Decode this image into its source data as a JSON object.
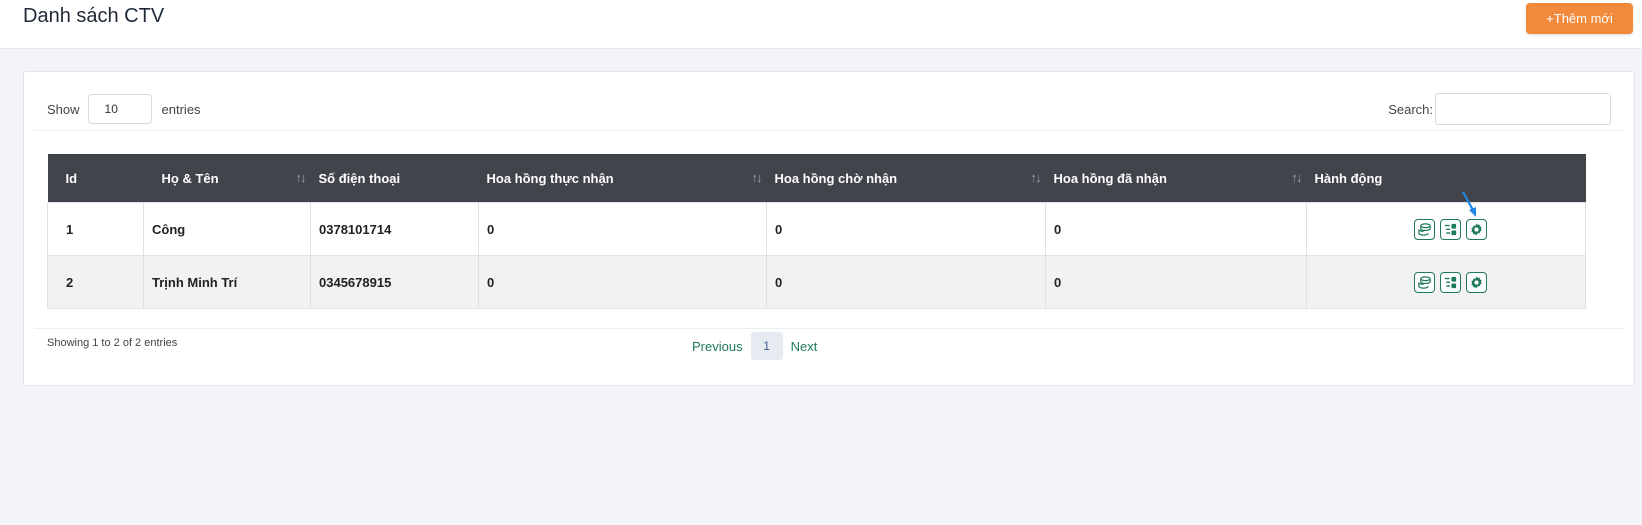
{
  "header": {
    "title": "Danh sách CTV",
    "add_button_label": "+Thêm mới"
  },
  "table_controls": {
    "show_label": "Show",
    "page_length": "10",
    "entries_label": "entries",
    "search_label": "Search:",
    "search_value": ""
  },
  "table": {
    "columns": [
      "Id",
      "Họ & Tên",
      "Số điện thoại",
      "Hoa hồng thực nhận",
      "Hoa hồng chờ nhận",
      "Hoa hồng đã nhận",
      "Hành động"
    ],
    "rows": [
      {
        "id": "1",
        "name": "Công",
        "phone": "0378101714",
        "actual": "0",
        "pending": "0",
        "received": "0"
      },
      {
        "id": "2",
        "name": "Trịnh Minh Trí",
        "phone": "0345678915",
        "actual": "0",
        "pending": "0",
        "received": "0"
      }
    ],
    "row_actions": [
      "coins-icon",
      "list-detail-icon",
      "gear-icon"
    ]
  },
  "footer": {
    "info": "Showing 1 to 2 of 2 entries",
    "previous": "Previous",
    "current_page": "1",
    "next": "Next"
  },
  "colors": {
    "accent": "#f28a3c",
    "header_bg": "#41444b",
    "icon_green": "#1f7a5a"
  }
}
